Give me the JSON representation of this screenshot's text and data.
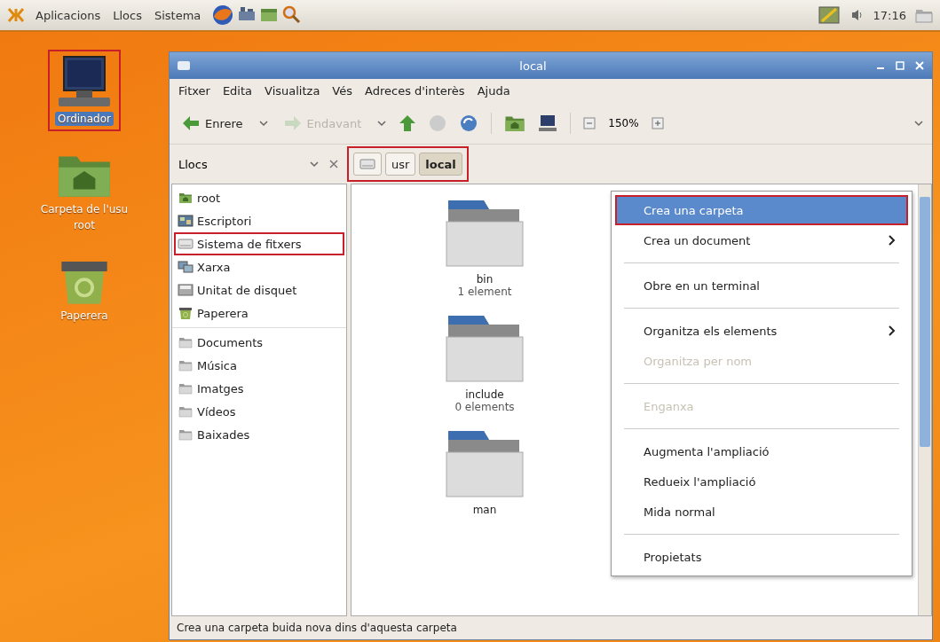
{
  "top_panel": {
    "menus": [
      {
        "label": "Aplicacions"
      },
      {
        "label": "Llocs"
      },
      {
        "label": "Sistema"
      }
    ],
    "clock": "17:16"
  },
  "desktop_icons": [
    {
      "kind": "computer",
      "lines": [
        "Ordinador"
      ],
      "selected": true,
      "highlighted": true
    },
    {
      "kind": "home",
      "lines": [
        "Carpeta de l'usu",
        "root"
      ],
      "selected": false,
      "highlighted": false
    },
    {
      "kind": "trash",
      "lines": [
        "Paperera"
      ],
      "selected": false,
      "highlighted": false
    }
  ],
  "window": {
    "title": "local",
    "menubar": [
      {
        "label": "Fitxer"
      },
      {
        "label": "Edita"
      },
      {
        "label": "Visualitza"
      },
      {
        "label": "Vés"
      },
      {
        "label": "Adreces d'interès"
      },
      {
        "label": "Ajuda"
      }
    ],
    "toolbar": {
      "back": {
        "label": "Enrere",
        "disabled": false
      },
      "forward": {
        "label": "Endavant",
        "disabled": true
      },
      "zoom": "150%"
    },
    "sidebar": {
      "title": "Llocs",
      "items": [
        {
          "kind": "home",
          "label": "root",
          "selected": false,
          "highlighted": false
        },
        {
          "kind": "desktop",
          "label": "Escriptori",
          "selected": false,
          "highlighted": false
        },
        {
          "kind": "drive",
          "label": "Sistema de fitxers",
          "selected": false,
          "highlighted": true
        },
        {
          "kind": "network",
          "label": "Xarxa",
          "selected": false,
          "highlighted": false
        },
        {
          "kind": "floppy",
          "label": "Unitat de disquet",
          "selected": false,
          "highlighted": false
        },
        {
          "kind": "trash",
          "label": "Paperera",
          "selected": false,
          "highlighted": false
        },
        {
          "kind": "separator"
        },
        {
          "kind": "folder",
          "label": "Documents",
          "selected": false,
          "highlighted": false
        },
        {
          "kind": "folder",
          "label": "Música",
          "selected": false,
          "highlighted": false
        },
        {
          "kind": "folder",
          "label": "Imatges",
          "selected": false,
          "highlighted": false
        },
        {
          "kind": "folder",
          "label": "Vídeos",
          "selected": false,
          "highlighted": false
        },
        {
          "kind": "folder",
          "label": "Baixades",
          "selected": false,
          "highlighted": false
        }
      ]
    },
    "location_bar": {
      "highlighted": true,
      "crumbs": [
        {
          "kind": "root",
          "selected": false
        },
        {
          "kind": "text",
          "label": "usr",
          "selected": false
        },
        {
          "kind": "text",
          "label": "local",
          "selected": true
        }
      ]
    },
    "files": [
      {
        "name": "bin",
        "info": "1 element"
      },
      {
        "name": "include",
        "info": "0 elements"
      },
      {
        "name": "man"
      }
    ],
    "context_menu": [
      {
        "kind": "item",
        "label": "Crea una carpeta",
        "selected": true,
        "disabled": false,
        "submenu": false,
        "highlighted": true
      },
      {
        "kind": "item",
        "label": "Crea un document",
        "selected": false,
        "disabled": false,
        "submenu": true,
        "highlighted": false
      },
      {
        "kind": "separator"
      },
      {
        "kind": "item",
        "label": "Obre en un terminal",
        "selected": false,
        "disabled": false,
        "submenu": false,
        "highlighted": false
      },
      {
        "kind": "separator"
      },
      {
        "kind": "item",
        "label": "Organitza els elements",
        "selected": false,
        "disabled": false,
        "submenu": true,
        "highlighted": false
      },
      {
        "kind": "item",
        "label": "Organitza per nom",
        "selected": false,
        "disabled": true,
        "submenu": false,
        "highlighted": false
      },
      {
        "kind": "separator"
      },
      {
        "kind": "item",
        "label": "Enganxa",
        "selected": false,
        "disabled": true,
        "submenu": false,
        "highlighted": false
      },
      {
        "kind": "separator"
      },
      {
        "kind": "item",
        "label": "Augmenta l'ampliació",
        "selected": false,
        "disabled": false,
        "submenu": false,
        "highlighted": false
      },
      {
        "kind": "item",
        "label": "Redueix l'ampliació",
        "selected": false,
        "disabled": false,
        "submenu": false,
        "highlighted": false
      },
      {
        "kind": "item",
        "label": "Mida normal",
        "selected": false,
        "disabled": false,
        "submenu": false,
        "highlighted": false
      },
      {
        "kind": "separator"
      },
      {
        "kind": "item",
        "label": "Propietats",
        "selected": false,
        "disabled": false,
        "submenu": false,
        "highlighted": false
      }
    ],
    "status_bar": "Crea una carpeta buida nova dins d'aquesta carpeta"
  }
}
